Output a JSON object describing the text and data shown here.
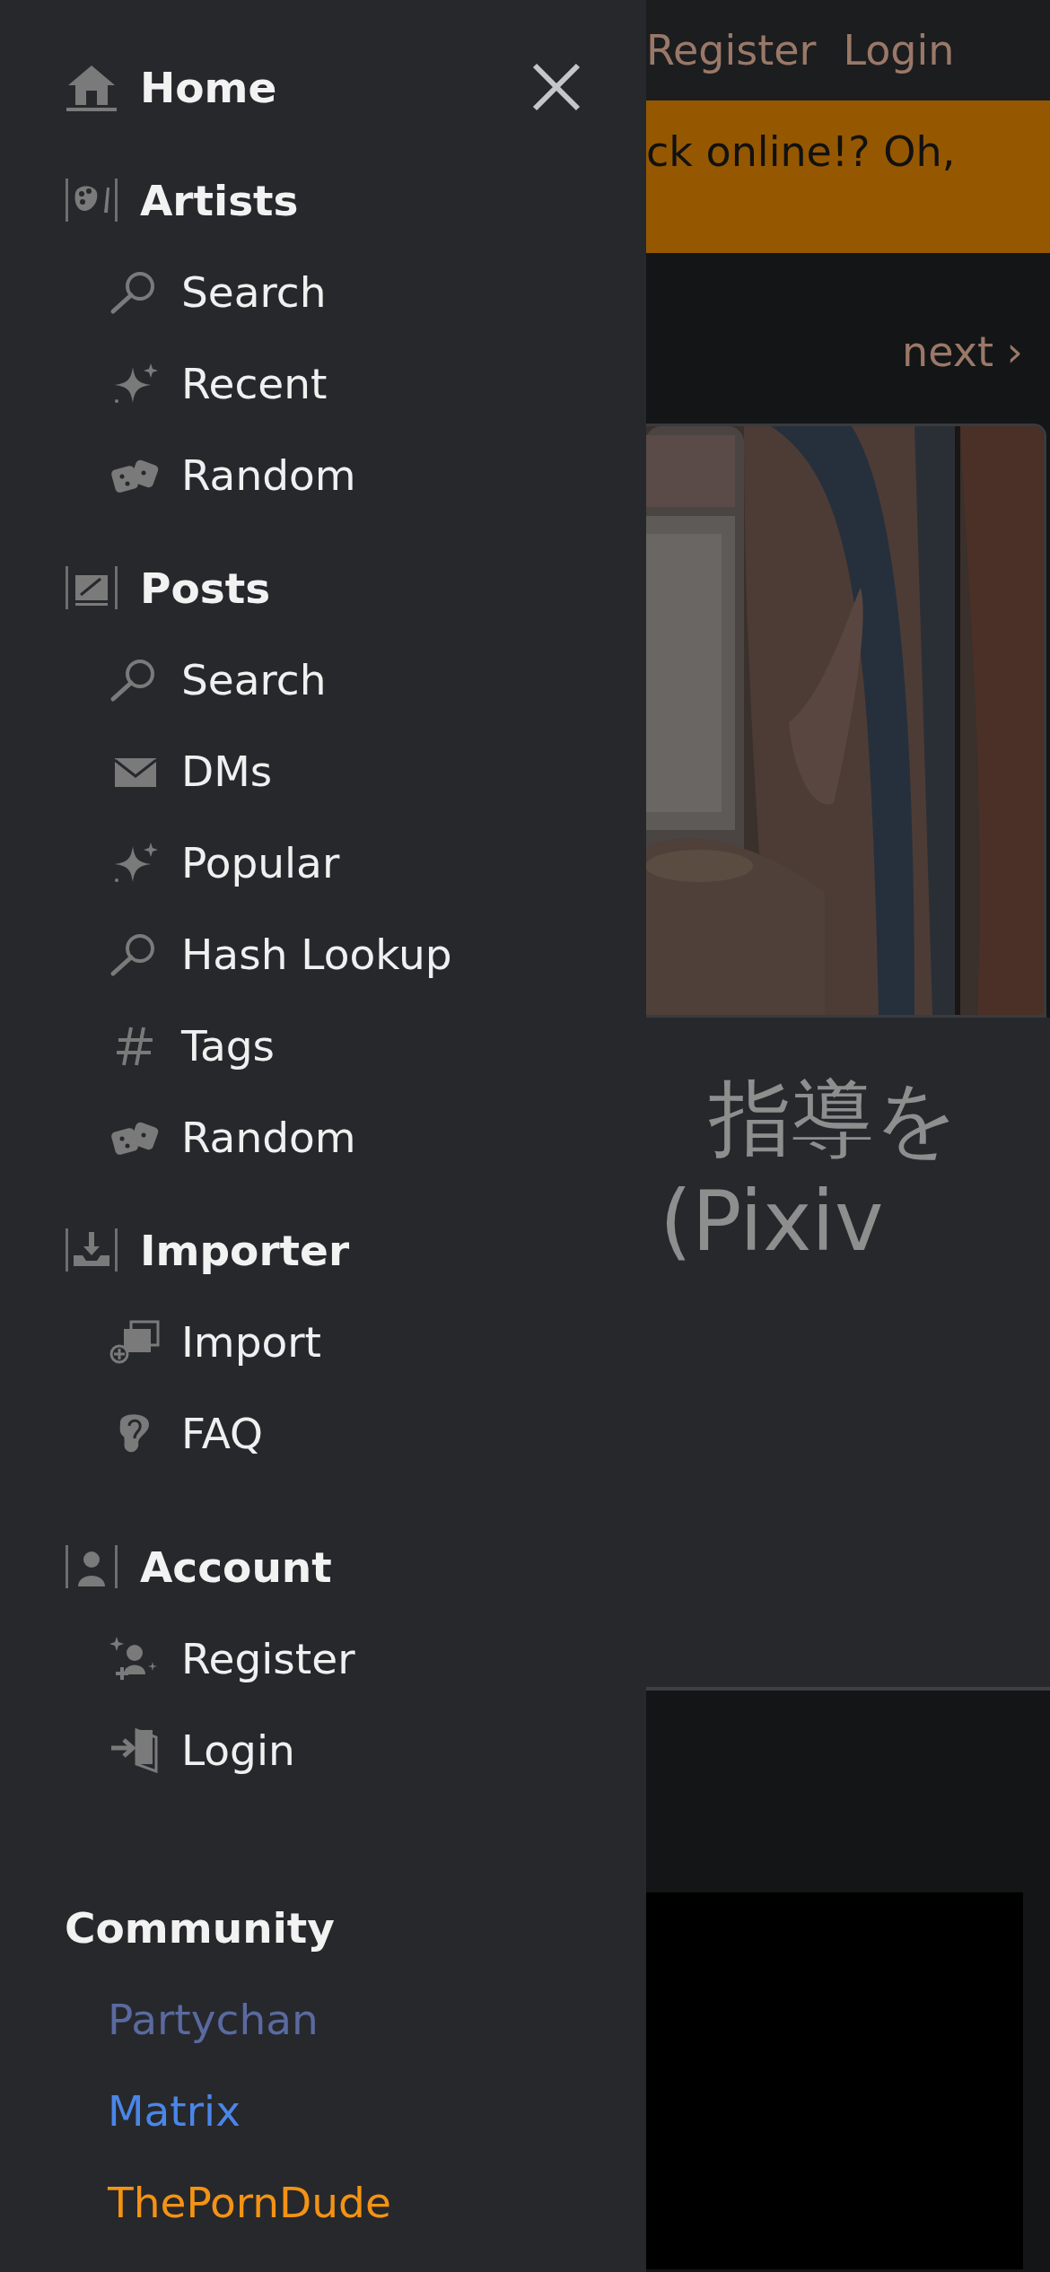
{
  "drawer": {
    "home": "Home",
    "sections": [
      {
        "title": "Artists",
        "kind": "artists",
        "items": [
          {
            "label": "Search",
            "kind": "search"
          },
          {
            "label": "Recent",
            "kind": "sparkle"
          },
          {
            "label": "Random",
            "kind": "dice"
          }
        ]
      },
      {
        "title": "Posts",
        "kind": "posts",
        "items": [
          {
            "label": "Search",
            "kind": "search"
          },
          {
            "label": "DMs",
            "kind": "mail"
          },
          {
            "label": "Popular",
            "kind": "sparkle"
          },
          {
            "label": "Hash Lookup",
            "kind": "search"
          },
          {
            "label": "Tags",
            "kind": "hash"
          },
          {
            "label": "Random",
            "kind": "dice"
          }
        ]
      },
      {
        "title": "Importer",
        "kind": "importer",
        "items": [
          {
            "label": "Import",
            "kind": "import"
          },
          {
            "label": "FAQ",
            "kind": "faq"
          }
        ]
      },
      {
        "title": "Account",
        "kind": "account",
        "items": [
          {
            "label": "Register",
            "kind": "register"
          },
          {
            "label": "Login",
            "kind": "login"
          }
        ]
      }
    ],
    "community": {
      "title": "Community",
      "links": [
        {
          "label": "Partychan",
          "color": "#5a6aa0"
        },
        {
          "label": "Matrix",
          "color": "#4a86e8"
        },
        {
          "label": "ThePornDude",
          "color": "#f39314"
        }
      ]
    }
  },
  "page": {
    "nav": [
      "Register",
      "Login"
    ],
    "banner": "ck online!? Oh,",
    "next": "next ›",
    "title_lines": [
      "指導を",
      "(Pixiv"
    ]
  }
}
